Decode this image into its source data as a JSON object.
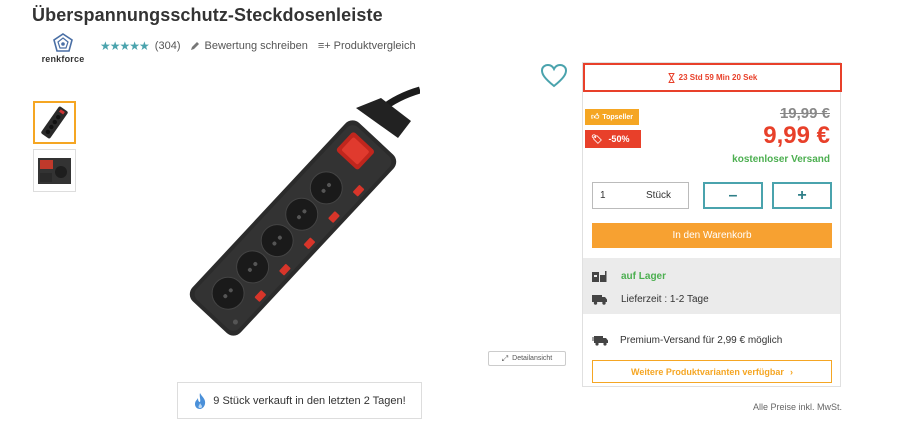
{
  "product": {
    "title": "Überspannungsschutz-Steckdosenleiste",
    "brand": "renkforce",
    "stars": "★★★★★",
    "rating_count": "(304)",
    "write_review": "Bewertung schreiben",
    "compare": "Produktvergleich",
    "compare_icon": "≡+"
  },
  "gallery": {
    "detail_view": "Detailansicht",
    "sold_text": "9 Stück verkauft in den letzten 2 Tagen!"
  },
  "offer": {
    "countdown": "23 Std 59 Min 20 Sek",
    "badge_top": "Topseller",
    "badge_discount": "-50%",
    "old_price": "19,99 €",
    "price": "9,99 €",
    "shipping": "kostenloser Versand",
    "quantity_value": "1",
    "quantity_unit": "Stück",
    "minus": "–",
    "plus": "+",
    "add_to_cart": "In den Warenkorb",
    "stock": "auf Lager",
    "delivery": "Lieferzeit : 1-2 Tage",
    "premium": "Premium-Versand für 2,99 € möglich",
    "variants": "Weitere Produktvarianten verfügbar",
    "variants_chevron": "›"
  },
  "footer": {
    "prices_note": "Alle Preise inkl. MwSt."
  },
  "colors": {
    "accent": "#4aa3ad",
    "orange": "#f7a131",
    "red": "#e8402a",
    "green": "#4caf50"
  }
}
